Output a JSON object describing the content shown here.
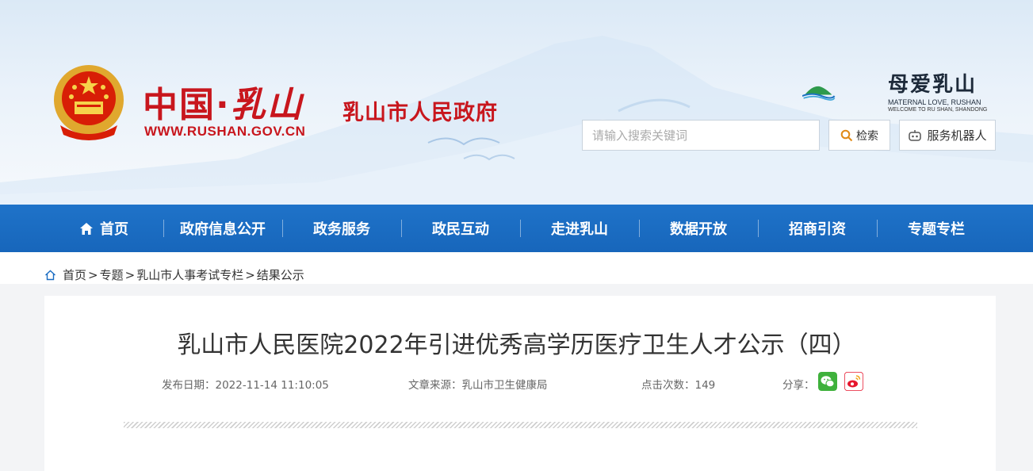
{
  "header": {
    "logo_title_cn": "中国",
    "logo_title_dot": "·",
    "logo_title_calligraphy": "乳山",
    "site_url": "WWW.RUSHAN.GOV.CN",
    "gov_name": "乳山市人民政府",
    "brand_title": "母爱乳山",
    "brand_sub1": "MATERNAL LOVE, RUSHAN",
    "brand_sub2": "WELCOME TO RU SHAN, SHANDONG",
    "search_placeholder": "请输入搜索关键词",
    "search_button": "检索",
    "robot_button": "服务机器人"
  },
  "nav": {
    "items": [
      {
        "label": "首页",
        "icon": "home-icon"
      },
      {
        "label": "政府信息公开"
      },
      {
        "label": "政务服务"
      },
      {
        "label": "政民互动"
      },
      {
        "label": "走进乳山"
      },
      {
        "label": "数据开放"
      },
      {
        "label": "招商引资"
      },
      {
        "label": "专题专栏"
      }
    ]
  },
  "breadcrumb": {
    "icon": "home-outline-icon",
    "items": [
      "首页",
      "专题",
      "乳山市人事考试专栏",
      "结果公示"
    ],
    "separator": ">"
  },
  "article": {
    "title": "乳山市人民医院2022年引进优秀高学历医疗卫生人才公示（四）",
    "publish_date_label": "发布日期：",
    "publish_date": "2022-11-14 11:10:05",
    "source_label": "文章来源：",
    "source": "乳山市卫生健康局",
    "views_label": "点击次数：",
    "views": "149",
    "share_label": "分享：",
    "share_icons": [
      "wechat-icon",
      "weibo-icon"
    ]
  },
  "colors": {
    "brand_red": "#c8161d",
    "nav_blue": "#1a6cc2",
    "wechat_green": "#3fb13c",
    "weibo_red": "#e6162d"
  }
}
